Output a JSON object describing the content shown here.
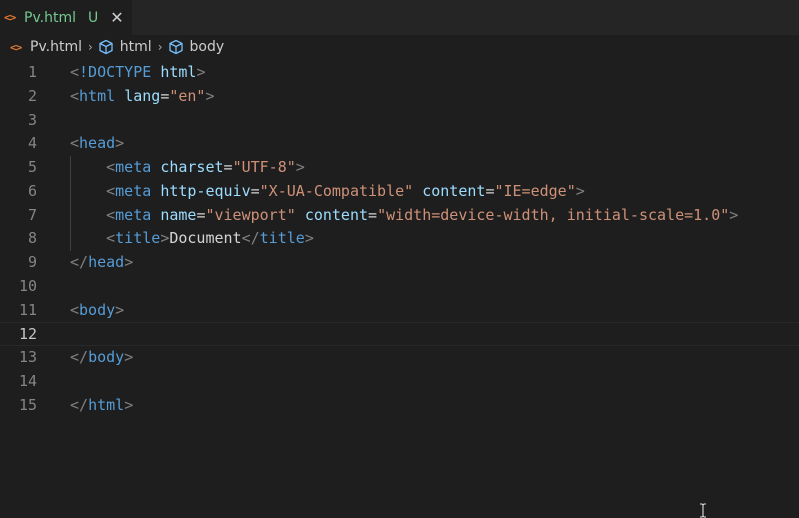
{
  "tab": {
    "file_icon": "<>",
    "name": "Pv.html",
    "status": "U",
    "close_icon": "✕"
  },
  "breadcrumb": {
    "file_icon": "<>",
    "items": [
      "Pv.html",
      "html",
      "body"
    ],
    "separator": "›"
  },
  "editor": {
    "current_line": 12,
    "lines": [
      {
        "n": "1",
        "tokens": [
          [
            "t-punc",
            "<"
          ],
          [
            "t-doctype-kw",
            "!DOCTYPE"
          ],
          [
            "t-text",
            " "
          ],
          [
            "t-attr",
            "html"
          ],
          [
            "t-punc",
            ">"
          ]
        ]
      },
      {
        "n": "2",
        "tokens": [
          [
            "t-punc",
            "<"
          ],
          [
            "t-tag",
            "html"
          ],
          [
            "t-text",
            " "
          ],
          [
            "t-attr",
            "lang"
          ],
          [
            "t-text",
            "="
          ],
          [
            "t-str",
            "\"en\""
          ],
          [
            "t-punc",
            ">"
          ]
        ]
      },
      {
        "n": "3",
        "tokens": []
      },
      {
        "n": "4",
        "tokens": [
          [
            "t-punc",
            "<"
          ],
          [
            "t-tag",
            "head"
          ],
          [
            "t-punc",
            ">"
          ]
        ]
      },
      {
        "n": "5",
        "indent": true,
        "tokens": [
          [
            "t-text",
            "    "
          ],
          [
            "t-punc",
            "<"
          ],
          [
            "t-tag",
            "meta"
          ],
          [
            "t-text",
            " "
          ],
          [
            "t-attr",
            "charset"
          ],
          [
            "t-text",
            "="
          ],
          [
            "t-str",
            "\"UTF-8\""
          ],
          [
            "t-punc",
            ">"
          ]
        ]
      },
      {
        "n": "6",
        "indent": true,
        "tokens": [
          [
            "t-text",
            "    "
          ],
          [
            "t-punc",
            "<"
          ],
          [
            "t-tag",
            "meta"
          ],
          [
            "t-text",
            " "
          ],
          [
            "t-attr",
            "http-equiv"
          ],
          [
            "t-text",
            "="
          ],
          [
            "t-str",
            "\"X-UA-Compatible\""
          ],
          [
            "t-text",
            " "
          ],
          [
            "t-attr",
            "content"
          ],
          [
            "t-text",
            "="
          ],
          [
            "t-str",
            "\"IE=edge\""
          ],
          [
            "t-punc",
            ">"
          ]
        ]
      },
      {
        "n": "7",
        "indent": true,
        "tokens": [
          [
            "t-text",
            "    "
          ],
          [
            "t-punc",
            "<"
          ],
          [
            "t-tag",
            "meta"
          ],
          [
            "t-text",
            " "
          ],
          [
            "t-attr",
            "name"
          ],
          [
            "t-text",
            "="
          ],
          [
            "t-str",
            "\"viewport\""
          ],
          [
            "t-text",
            " "
          ],
          [
            "t-attr",
            "content"
          ],
          [
            "t-text",
            "="
          ],
          [
            "t-str",
            "\"width=device-width, initial-scale=1.0\""
          ],
          [
            "t-punc",
            ">"
          ]
        ]
      },
      {
        "n": "8",
        "indent": true,
        "tokens": [
          [
            "t-text",
            "    "
          ],
          [
            "t-punc",
            "<"
          ],
          [
            "t-tag",
            "title"
          ],
          [
            "t-punc",
            ">"
          ],
          [
            "t-text",
            "Document"
          ],
          [
            "t-punc",
            "</"
          ],
          [
            "t-tag",
            "title"
          ],
          [
            "t-punc",
            ">"
          ]
        ]
      },
      {
        "n": "9",
        "tokens": [
          [
            "t-punc",
            "</"
          ],
          [
            "t-tag",
            "head"
          ],
          [
            "t-punc",
            ">"
          ]
        ]
      },
      {
        "n": "10",
        "tokens": []
      },
      {
        "n": "11",
        "tokens": [
          [
            "t-punc",
            "<"
          ],
          [
            "t-tag",
            "body"
          ],
          [
            "t-punc",
            ">"
          ]
        ]
      },
      {
        "n": "12",
        "tokens": []
      },
      {
        "n": "13",
        "tokens": [
          [
            "t-punc",
            "</"
          ],
          [
            "t-tag",
            "body"
          ],
          [
            "t-punc",
            ">"
          ]
        ]
      },
      {
        "n": "14",
        "tokens": []
      },
      {
        "n": "15",
        "tokens": [
          [
            "t-punc",
            "</"
          ],
          [
            "t-tag",
            "html"
          ],
          [
            "t-punc",
            ">"
          ]
        ]
      }
    ]
  },
  "colors": {
    "background": "#1e1e1e",
    "tabbar": "#252526",
    "tag": "#569cd6",
    "attribute": "#9cdcfe",
    "string": "#ce9178",
    "punctuation": "#808080",
    "modified_file": "#73c991",
    "html_icon": "#e37933"
  },
  "icons": {
    "breadcrumb_symbol": "cube-icon",
    "mouse_cursor": "text-cursor-icon"
  }
}
